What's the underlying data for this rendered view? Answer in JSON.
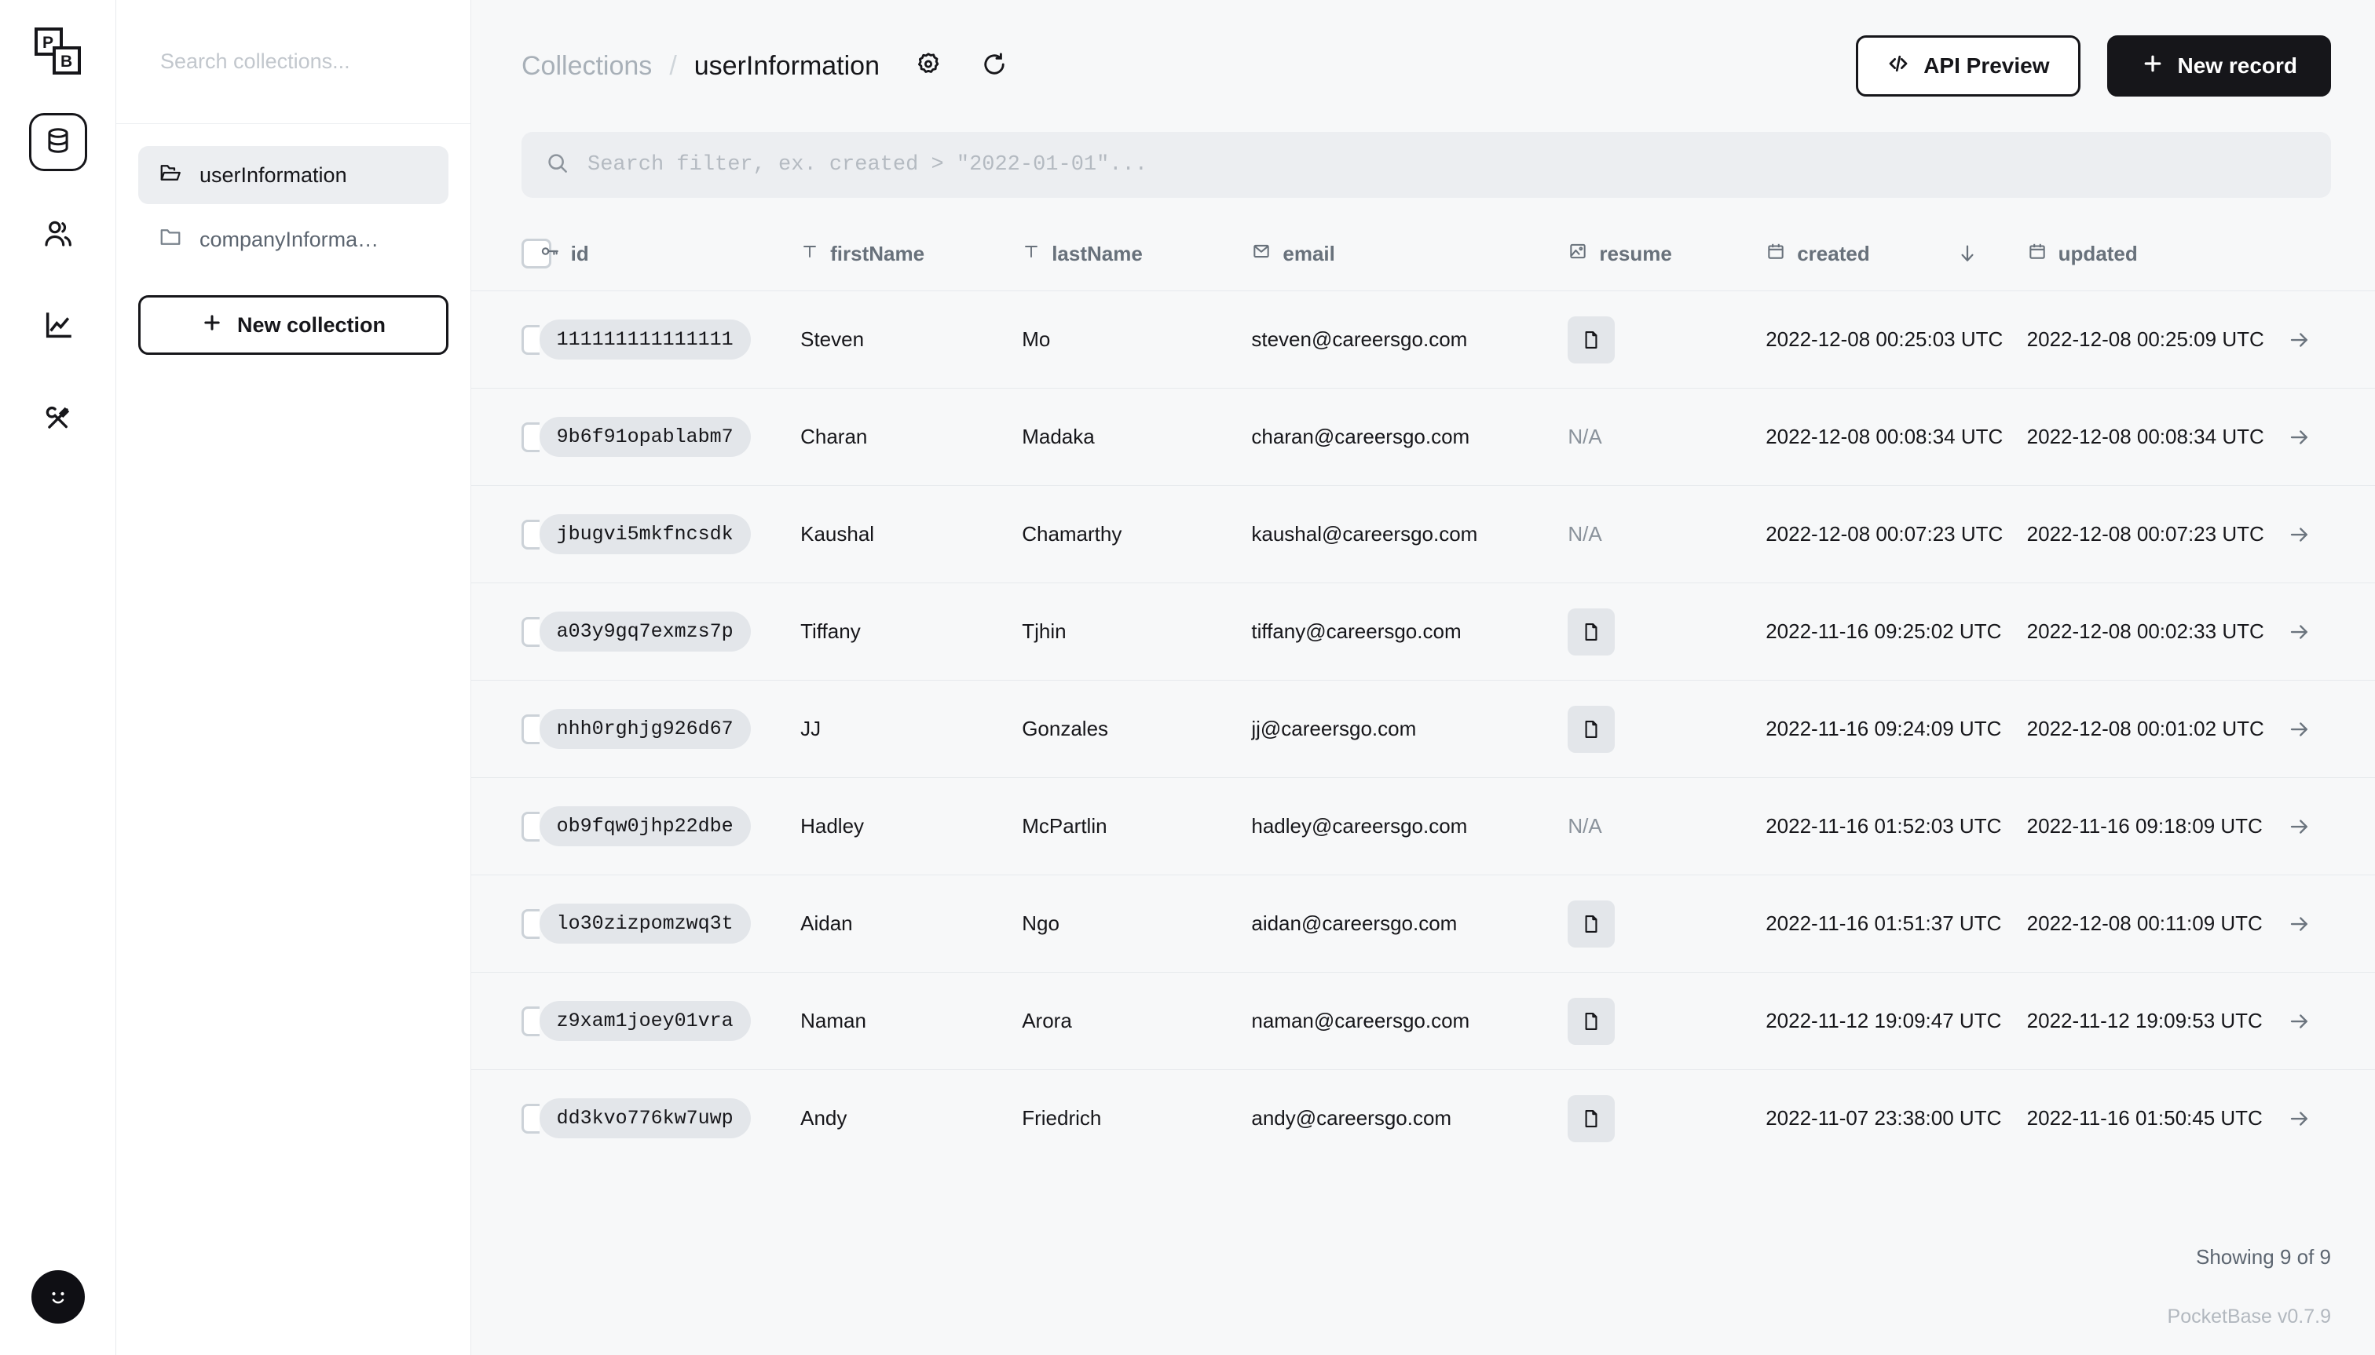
{
  "rail": {
    "logo_name": "pocketbase-logo",
    "items": [
      {
        "name": "collections",
        "icon": "database-icon",
        "active": true
      },
      {
        "name": "users",
        "icon": "users-icon",
        "active": false
      },
      {
        "name": "logs",
        "icon": "chart-line-icon",
        "active": false
      },
      {
        "name": "settings",
        "icon": "tools-icon",
        "active": false
      }
    ],
    "avatar_icon": "smiley-avatar-icon"
  },
  "collections_panel": {
    "search_placeholder": "Search collections...",
    "items": [
      {
        "label": "userInformation",
        "icon": "folder-open-icon",
        "active": true
      },
      {
        "label": "companyInforma…",
        "icon": "folder-icon",
        "active": false
      }
    ],
    "new_collection_label": "New collection"
  },
  "header": {
    "breadcrumb_root": "Collections",
    "breadcrumb_separator": "/",
    "breadcrumb_current": "userInformation",
    "gear_icon": "gear-icon",
    "refresh_icon": "refresh-icon",
    "api_preview_label": "API Preview",
    "new_record_label": "New record"
  },
  "filter": {
    "placeholder": "Search filter, ex. created > \"2022-01-01\"...",
    "value": "",
    "search_icon": "search-icon"
  },
  "table": {
    "columns": [
      {
        "key": "id",
        "label": "id",
        "icon": "key-icon",
        "sorted": false
      },
      {
        "key": "firstName",
        "label": "firstName",
        "icon": "text-icon",
        "sorted": false
      },
      {
        "key": "lastName",
        "label": "lastName",
        "icon": "text-icon",
        "sorted": false
      },
      {
        "key": "email",
        "label": "email",
        "icon": "envelope-icon",
        "sorted": false
      },
      {
        "key": "resume",
        "label": "resume",
        "icon": "image-icon",
        "sorted": false
      },
      {
        "key": "created",
        "label": "created",
        "icon": "calendar-icon",
        "sorted": true,
        "sort_dir": "desc"
      },
      {
        "key": "updated",
        "label": "updated",
        "icon": "calendar-icon",
        "sorted": false
      }
    ],
    "rows": [
      {
        "id": "111111111111111",
        "firstName": "Steven",
        "lastName": "Mo",
        "email": "steven@careersgo.com",
        "resume": "file",
        "created": "2022-12-08 00:25:03 UTC",
        "updated": "2022-12-08 00:25:09 UTC"
      },
      {
        "id": "9b6f91opablabm7",
        "firstName": "Charan",
        "lastName": "Madaka",
        "email": "charan@careersgo.com",
        "resume": "N/A",
        "created": "2022-12-08 00:08:34 UTC",
        "updated": "2022-12-08 00:08:34 UTC"
      },
      {
        "id": "jbugvi5mkfncsdk",
        "firstName": "Kaushal",
        "lastName": "Chamarthy",
        "email": "kaushal@careersgo.com",
        "resume": "N/A",
        "created": "2022-12-08 00:07:23 UTC",
        "updated": "2022-12-08 00:07:23 UTC"
      },
      {
        "id": "a03y9gq7exmzs7p",
        "firstName": "Tiffany",
        "lastName": "Tjhin",
        "email": "tiffany@careersgo.com",
        "resume": "file",
        "created": "2022-11-16 09:25:02 UTC",
        "updated": "2022-12-08 00:02:33 UTC"
      },
      {
        "id": "nhh0rghjg926d67",
        "firstName": "JJ",
        "lastName": "Gonzales",
        "email": "jj@careersgo.com",
        "resume": "file",
        "created": "2022-11-16 09:24:09 UTC",
        "updated": "2022-12-08 00:01:02 UTC"
      },
      {
        "id": "ob9fqw0jhp22dbe",
        "firstName": "Hadley",
        "lastName": "McPartlin",
        "email": "hadley@careersgo.com",
        "resume": "N/A",
        "created": "2022-11-16 01:52:03 UTC",
        "updated": "2022-11-16 09:18:09 UTC"
      },
      {
        "id": "lo30zizpomzwq3t",
        "firstName": "Aidan",
        "lastName": "Ngo",
        "email": "aidan@careersgo.com",
        "resume": "file",
        "created": "2022-11-16 01:51:37 UTC",
        "updated": "2022-12-08 00:11:09 UTC"
      },
      {
        "id": "z9xam1joey01vra",
        "firstName": "Naman",
        "lastName": "Arora",
        "email": "naman@careersgo.com",
        "resume": "file",
        "created": "2022-11-12 19:09:47 UTC",
        "updated": "2022-11-12 19:09:53 UTC"
      },
      {
        "id": "dd3kvo776kw7uwp",
        "firstName": "Andy",
        "lastName": "Friedrich",
        "email": "andy@careersgo.com",
        "resume": "file",
        "created": "2022-11-07 23:38:00 UTC",
        "updated": "2022-11-16 01:50:45 UTC"
      }
    ],
    "row_arrow_icon": "arrow-right-icon",
    "na_label": "N/A"
  },
  "footer": {
    "showing": "Showing 9 of 9",
    "version": "PocketBase v0.7.9"
  },
  "colors": {
    "accent": "#16161a",
    "panel_bg": "#ffffff",
    "app_bg": "#f7f8f9",
    "muted": "#68717b",
    "pill_bg": "#e3e6ea"
  }
}
